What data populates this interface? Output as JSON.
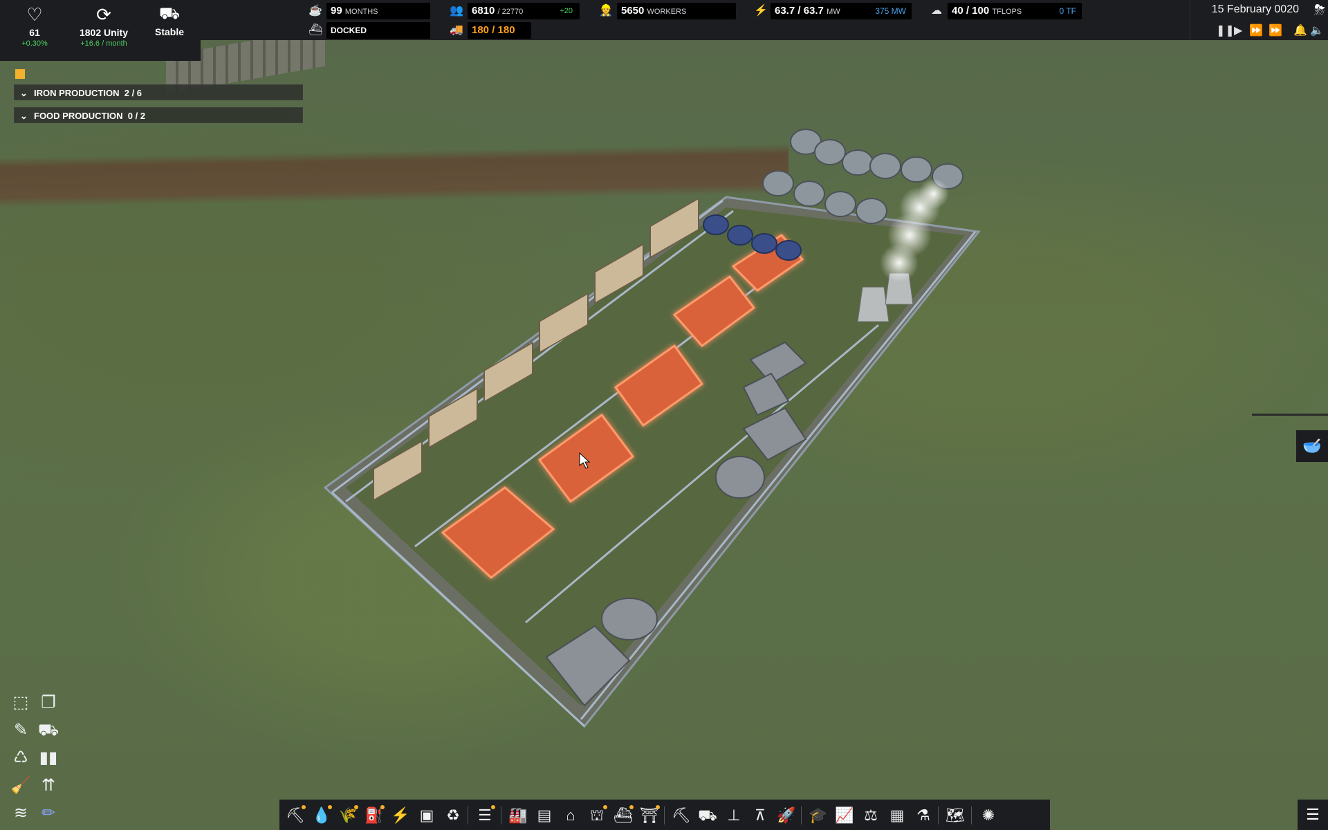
{
  "stats": {
    "health": {
      "icon": "heart-icon",
      "value": "61",
      "change": "+0.30%"
    },
    "unity": {
      "icon": "unity-icon",
      "value": "1802 Unity",
      "change": "+16.6 / month"
    },
    "status": {
      "icon": "truck-icon",
      "value": "Stable"
    }
  },
  "resources": {
    "food": {
      "value": "99",
      "unit": "MONTHS"
    },
    "ship": {
      "value": "DOCKED"
    },
    "population": {
      "value": "6810",
      "max": "/ 22770",
      "change": "+20"
    },
    "vehicles": {
      "value": "180 / 180"
    },
    "workers": {
      "value": "5650",
      "unit": "WORKERS"
    },
    "power": {
      "value": "63.7 / 63.7",
      "unit": "MW",
      "capacity": "375 MW"
    },
    "computing": {
      "value": "40 / 100",
      "unit": "TFLOPS",
      "capacity": "0 TF"
    }
  },
  "date": "15 February 0020",
  "goals": [
    {
      "label": "IRON PRODUCTION",
      "progress": "2 / 6"
    },
    {
      "label": "FOOD PRODUCTION",
      "progress": "0 / 2"
    }
  ],
  "colors": {
    "accent_green": "#4cd363",
    "accent_blue": "#49a3e6",
    "accent_orange": "#ff9f1a",
    "panel": "#1c1d20"
  }
}
